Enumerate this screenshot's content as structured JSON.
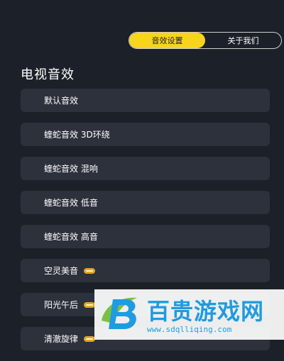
{
  "tabs": [
    {
      "label": "音效设置",
      "active": true
    },
    {
      "label": "关于我们",
      "active": false
    }
  ],
  "section_title": "电视音效",
  "items": [
    {
      "label": "默认音效",
      "vip": false
    },
    {
      "label": "蝰蛇音效 3D环绕",
      "vip": false
    },
    {
      "label": "蝰蛇音效 混响",
      "vip": false
    },
    {
      "label": "蝰蛇音效 低音",
      "vip": false
    },
    {
      "label": "蝰蛇音效 高音",
      "vip": false
    },
    {
      "label": "空灵美音",
      "vip": true
    },
    {
      "label": "阳光午后",
      "vip": true
    },
    {
      "label": "清澈旋律",
      "vip": true
    }
  ],
  "watermark": {
    "title": "百贵游戏网",
    "url": "www.sdqlliqing.com"
  },
  "colors": {
    "background": "#1c2029",
    "item_background": "#2c313b",
    "accent": "#f7d51d",
    "watermark_blue": "#1f9be0"
  }
}
